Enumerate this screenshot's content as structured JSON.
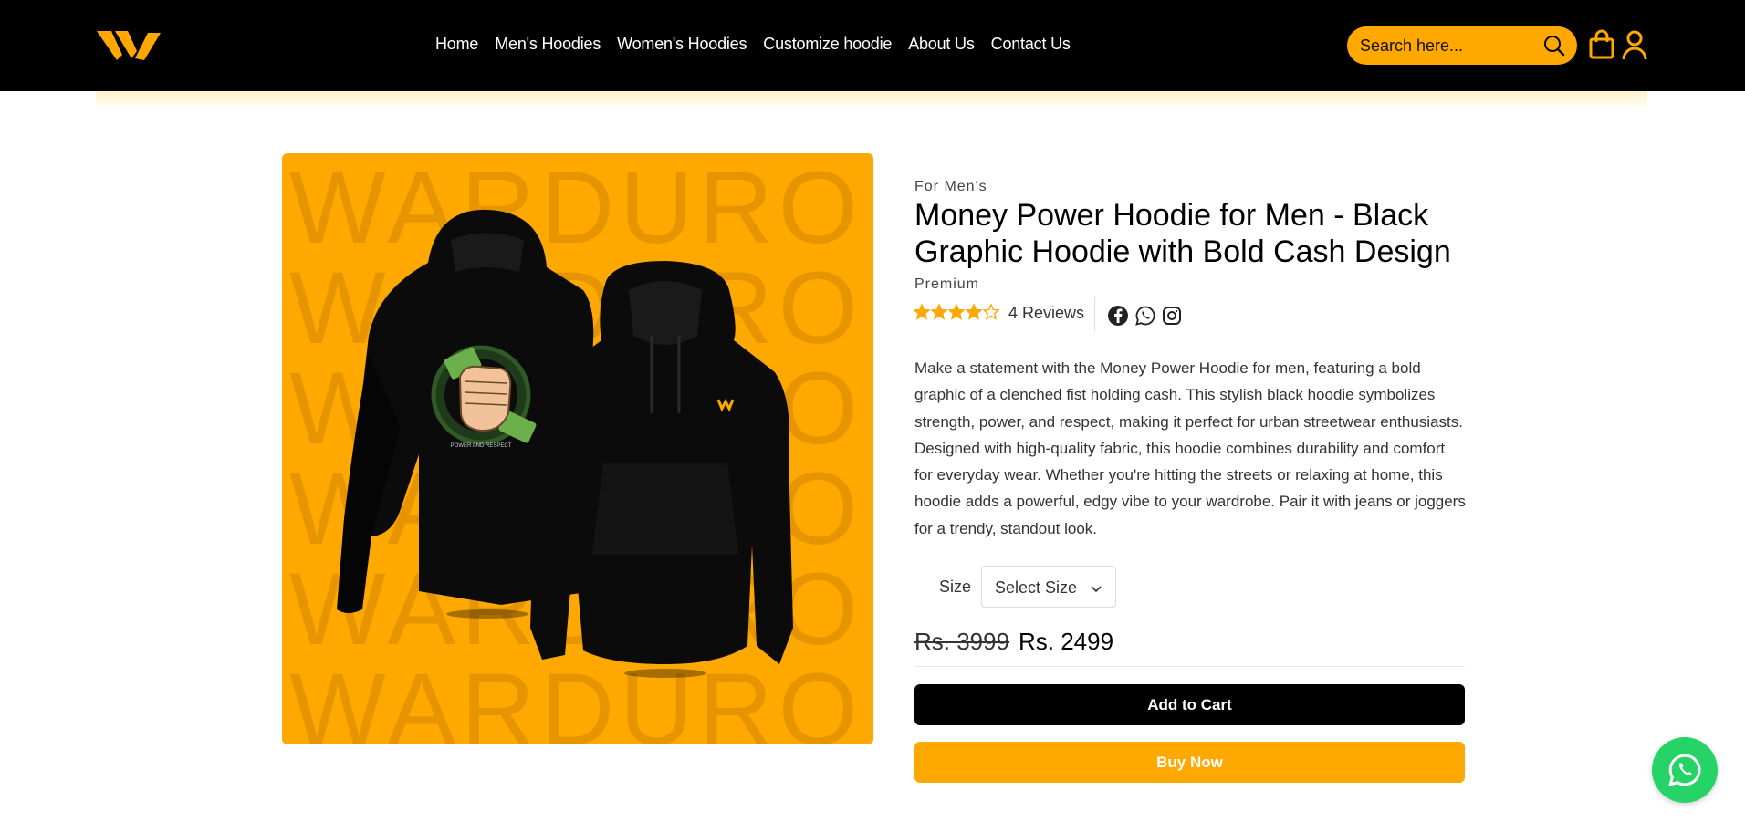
{
  "brand": {
    "logo_icon": "warduro-w-logo",
    "accent": "#ffa800"
  },
  "nav": {
    "items": [
      {
        "label": "Home"
      },
      {
        "label": "Men's Hoodies"
      },
      {
        "label": "Women's Hoodies"
      },
      {
        "label": "Customize hoodie"
      },
      {
        "label": "About Us"
      },
      {
        "label": "Contact Us"
      }
    ]
  },
  "search": {
    "placeholder": "Search here...",
    "icon": "search-icon"
  },
  "header_icons": {
    "cart": "shopping-bag-icon",
    "account": "user-icon"
  },
  "product": {
    "image": {
      "watermark": [
        "WARDURO",
        "WARDURO",
        "WARDURO",
        "WARDURO",
        "WARDURO",
        "WARDURO"
      ],
      "artwork_text": "POWER AND RESPECT",
      "background": "#ffa800"
    },
    "category": "For Men's",
    "title": "Money Power Hoodie for Men - Black Graphic Hoodie with Bold Cash Design",
    "tag": "Premium",
    "rating": {
      "value": 4,
      "max": 5
    },
    "reviews": "4 Reviews",
    "share": [
      "facebook-icon",
      "whatsapp-icon",
      "instagram-icon"
    ],
    "description": "Make a statement with the Money Power Hoodie for men, featuring a bold graphic of a clenched fist holding cash. This stylish black hoodie symbolizes strength, power, and respect, making it perfect for urban streetwear enthusiasts. Designed with high-quality fabric, this hoodie combines durability and comfort for everyday wear. Whether you're hitting the streets or relaxing at home, this hoodie adds a powerful, edgy vibe to your wardrobe. Pair it with jeans or joggers for a trendy, standout look.",
    "size": {
      "label": "Size",
      "selected": "Select Size"
    },
    "price": {
      "old": "Rs. 3999",
      "new": "Rs. 2499"
    },
    "buttons": {
      "add_to_cart": "Add to Cart",
      "buy_now": "Buy Now"
    }
  },
  "floating": {
    "whatsapp": "whatsapp-icon",
    "color": "#25d366"
  }
}
